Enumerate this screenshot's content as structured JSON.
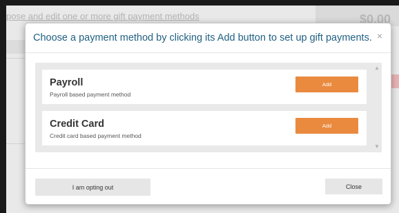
{
  "background": {
    "header_text": "pose and edit one or more gift payment methods",
    "total": "$0.00"
  },
  "modal": {
    "title": "Choose a payment method by clicking its Add button to set up gift payments.",
    "close_icon": "×",
    "methods": [
      {
        "name": "Payroll",
        "description": "Payroll based payment method",
        "add_label": "Add"
      },
      {
        "name": "Credit Card",
        "description": "Credit card based payment method",
        "add_label": "Add"
      }
    ],
    "opt_out_label": "I am opting out",
    "close_label": "Close"
  },
  "colors": {
    "accent": "#ea8a3f",
    "title": "#1f5f82"
  },
  "icons": {
    "scroll_up": "chevron-up-icon",
    "scroll_down": "chevron-down-icon"
  }
}
